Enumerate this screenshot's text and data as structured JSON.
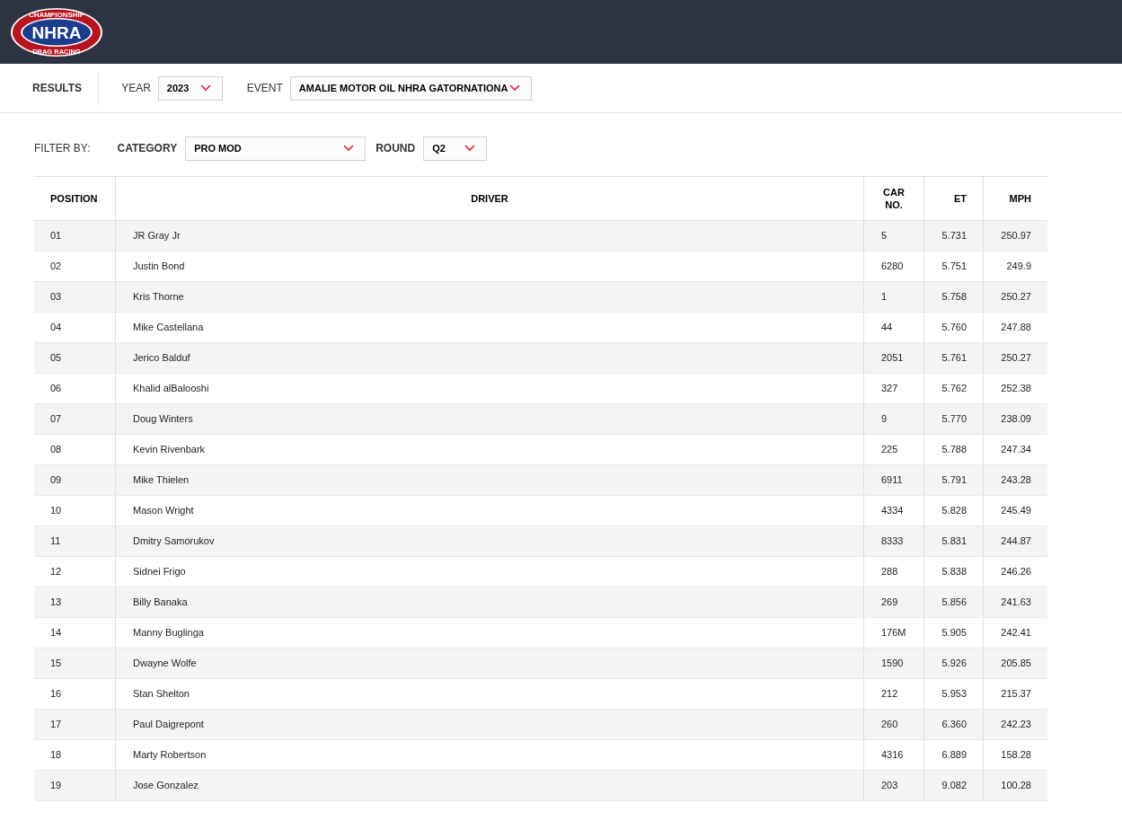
{
  "logo": {
    "top": "CHAMPIONSHIP",
    "main": "NHRA",
    "bottom": "DRAG RACING"
  },
  "toolbar": {
    "title": "RESULTS",
    "year": {
      "label": "YEAR",
      "value": "2023"
    },
    "event": {
      "label": "EVENT",
      "value": "AMALIE MOTOR OIL NHRA GATORNATIONA"
    }
  },
  "filter": {
    "label": "FILTER BY:",
    "category": {
      "label": "CATEGORY",
      "value": "PRO MOD"
    },
    "round": {
      "label": "ROUND",
      "value": "Q2"
    }
  },
  "table": {
    "columns": [
      "POSITION",
      "DRIVER",
      "CAR NO.",
      "ET",
      "MPH"
    ],
    "rows": [
      [
        "01",
        "JR Gray Jr",
        "5",
        "5.731",
        "250.97"
      ],
      [
        "02",
        "Justin Bond",
        "6280",
        "5.751",
        "249.9"
      ],
      [
        "03",
        "Kris Thorne",
        "1",
        "5.758",
        "250.27"
      ],
      [
        "04",
        "Mike Castellana",
        "44",
        "5.760",
        "247.88"
      ],
      [
        "05",
        "Jerico Balduf",
        "2051",
        "5.761",
        "250.27"
      ],
      [
        "06",
        "Khalid alBalooshi",
        "327",
        "5.762",
        "252.38"
      ],
      [
        "07",
        "Doug Winters",
        "9",
        "5.770",
        "238.09"
      ],
      [
        "08",
        "Kevin Rivenbark",
        "225",
        "5.788",
        "247.34"
      ],
      [
        "09",
        "Mike Thielen",
        "6911",
        "5.791",
        "243.28"
      ],
      [
        "10",
        "Mason Wright",
        "4334",
        "5.828",
        "245.49"
      ],
      [
        "11",
        "Dmitry Samorukov",
        "8333",
        "5.831",
        "244.87"
      ],
      [
        "12",
        "Sidnei Frigo",
        "288",
        "5.838",
        "246.26"
      ],
      [
        "13",
        "Billy Banaka",
        "269",
        "5.856",
        "241.63"
      ],
      [
        "14",
        "Manny Buglinga",
        "176M",
        "5.905",
        "242.41"
      ],
      [
        "15",
        "Dwayne Wolfe",
        "1590",
        "5.926",
        "205.85"
      ],
      [
        "16",
        "Stan Shelton",
        "212",
        "5.953",
        "215.37"
      ],
      [
        "17",
        "Paul Daigrepont",
        "260",
        "6.360",
        "242.23"
      ],
      [
        "18",
        "Marty Robertson",
        "4316",
        "6.889",
        "158.28"
      ],
      [
        "19",
        "Jose Gonzalez",
        "203",
        "9.082",
        "100.28"
      ]
    ]
  }
}
